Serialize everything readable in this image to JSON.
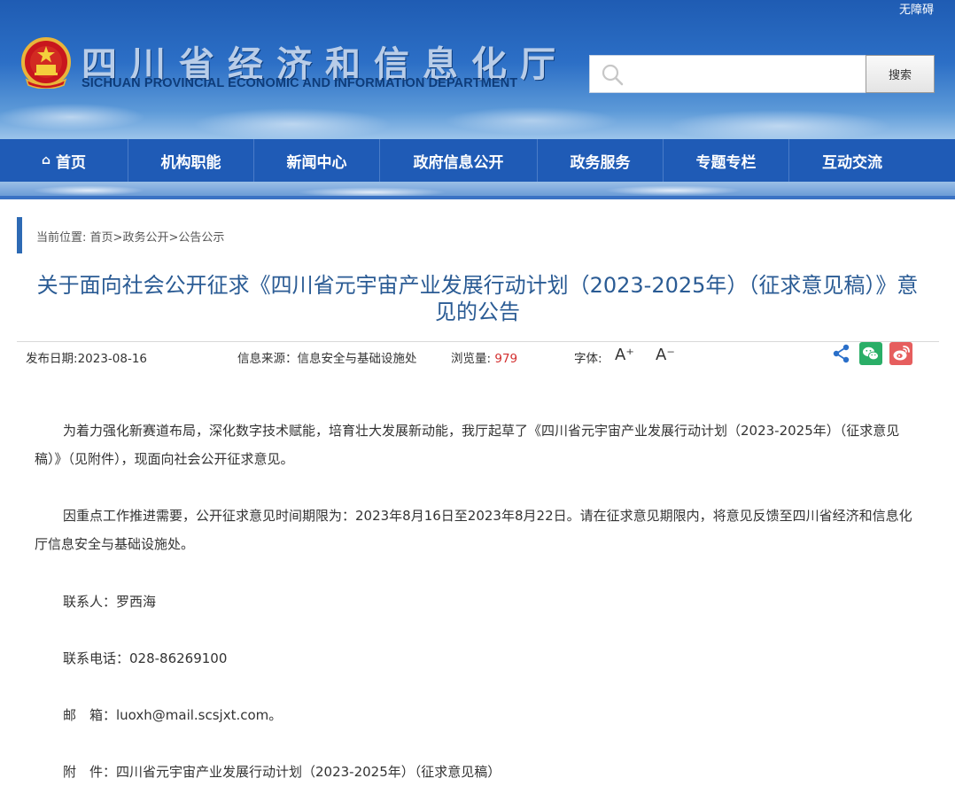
{
  "header": {
    "accessibility": "无障碍",
    "title_cn": "四川省经济和信息化厅",
    "title_en": "SICHUAN PROVINCIAL ECONOMIC AND INFORMATION DEPARTMENT",
    "search_placeholder": "",
    "search_button": "搜索"
  },
  "nav": {
    "items": [
      {
        "label": "首页",
        "icon": "home-icon"
      },
      {
        "label": "机构职能"
      },
      {
        "label": "新闻中心"
      },
      {
        "label": "政府信息公开"
      },
      {
        "label": "政务服务"
      },
      {
        "label": "专题专栏"
      },
      {
        "label": "互动交流"
      }
    ]
  },
  "breadcrumb": {
    "prefix": "当前位置:",
    "items": [
      "首页",
      "政务公开",
      "公告公示"
    ],
    "separator": ">"
  },
  "article": {
    "title": "关于面向社会公开征求《四川省元宇宙产业发展行动计划（2023-2025年）（征求意见稿）》意见的公告",
    "meta": {
      "publish_label": "发布日期:",
      "publish_date": "2023-08-16",
      "source_label": "信息来源：",
      "source": "信息安全与基础设施处",
      "views_label": "浏览量:",
      "views": "979",
      "font_label": "字体:",
      "font_increase": "A⁺",
      "font_decrease": "A⁻"
    },
    "share_icons": [
      "share-icon",
      "wechat-icon",
      "weibo-icon"
    ],
    "accent_colors": {
      "wechat": "#2aae67",
      "weibo": "#e65e5e",
      "share": "#2a6fc9"
    },
    "paragraphs": [
      "为着力强化新赛道布局，深化数字技术赋能，培育壮大发展新动能，我厅起草了《四川省元宇宙产业发展行动计划（2023-2025年）（征求意见稿）》（见附件），现面向社会公开征求意见。",
      "因重点工作推进需要，公开征求意见时间期限为：2023年8月16日至2023年8月22日。请在征求意见期限内，将意见反馈至四川省经济和信息化厅信息安全与基础设施处。"
    ],
    "contact_person": "联系人：罗西海",
    "contact_phone": "联系电话：028-86269100",
    "email": "邮　箱：luoxh@mail.scsjxt.com。",
    "attachment": "附　件：四川省元宇宙产业发展行动计划（2023-2025年）（征求意见稿）"
  }
}
